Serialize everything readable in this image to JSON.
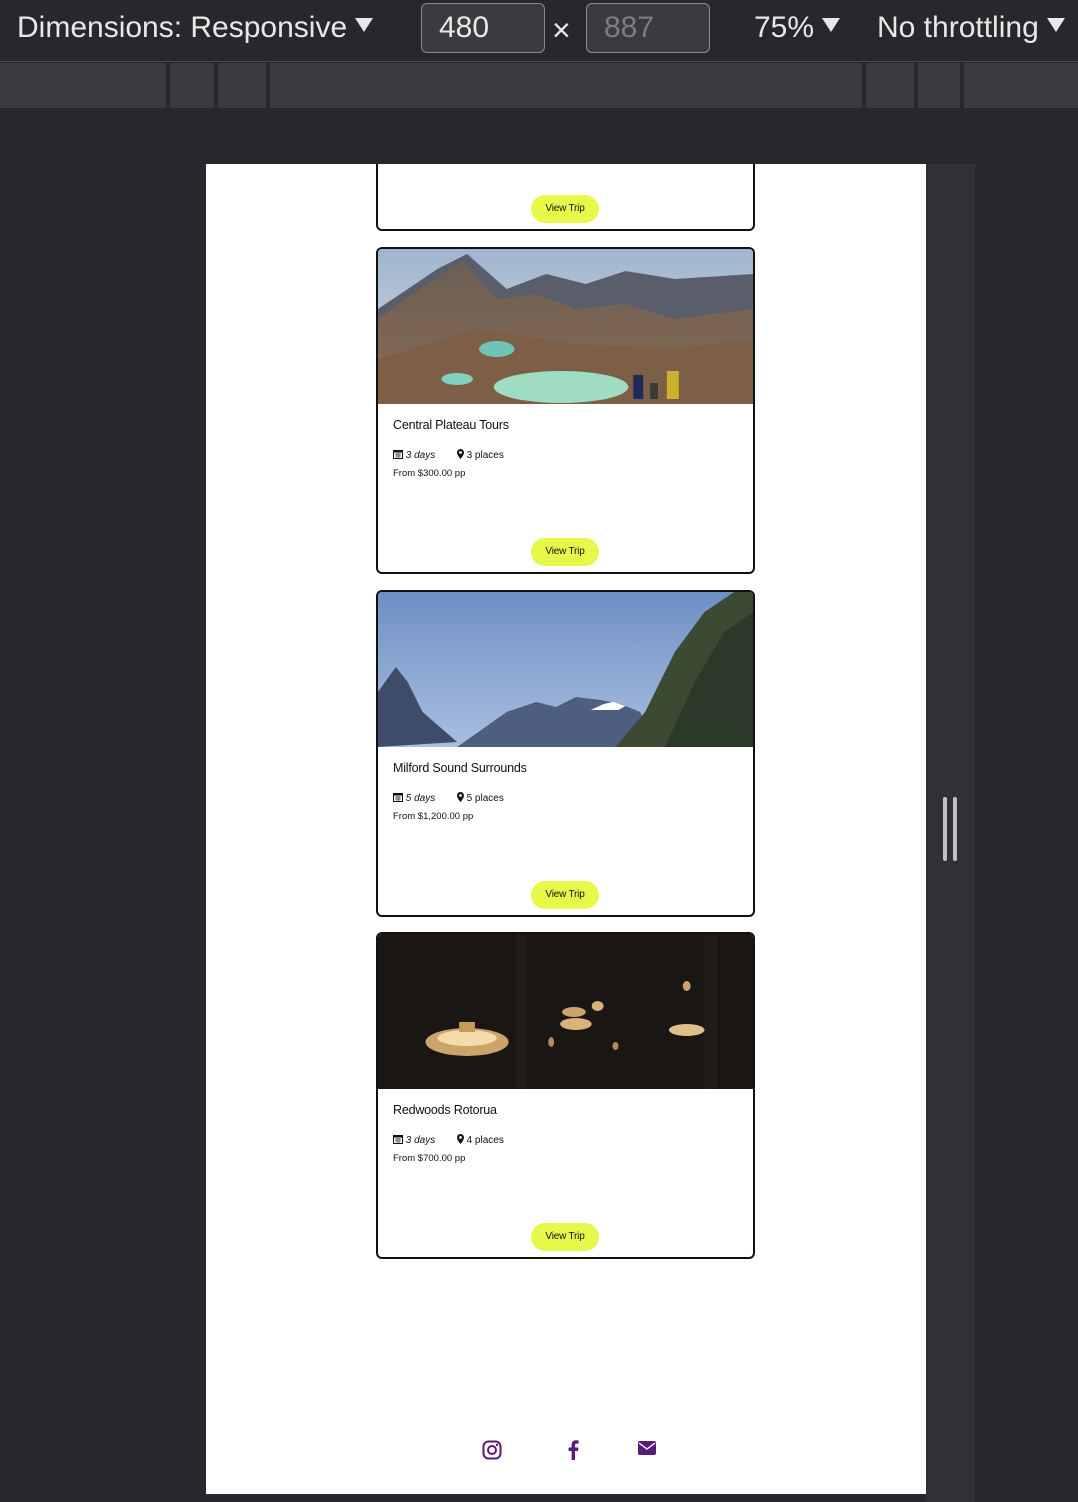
{
  "devtools": {
    "dimensions_label": "Dimensions: Responsive",
    "width_value": "480",
    "height_placeholder": "887",
    "times": "×",
    "zoom": "75%",
    "throttling": "No throttling"
  },
  "top_card": {
    "button_label": "View Trip"
  },
  "trips": [
    {
      "title": "Central Plateau Tours",
      "days": "3 days",
      "places": "3 places",
      "price": "From $300.00 pp",
      "button_label": "View Trip"
    },
    {
      "title": "Milford Sound Surrounds",
      "days": "5 days",
      "places": "5 places",
      "price": "From $1,200.00 pp",
      "button_label": "View Trip"
    },
    {
      "title": "Redwoods Rotorua",
      "days": "3 days",
      "places": "4 places",
      "price": "From $700.00 pp",
      "button_label": "View Trip"
    }
  ],
  "footer": {
    "icons": [
      "instagram-icon",
      "facebook-icon",
      "envelope-icon"
    ],
    "icon_color": "#5a1a78"
  },
  "colors": {
    "button": "#e6f94a",
    "card_border": "#111111"
  }
}
